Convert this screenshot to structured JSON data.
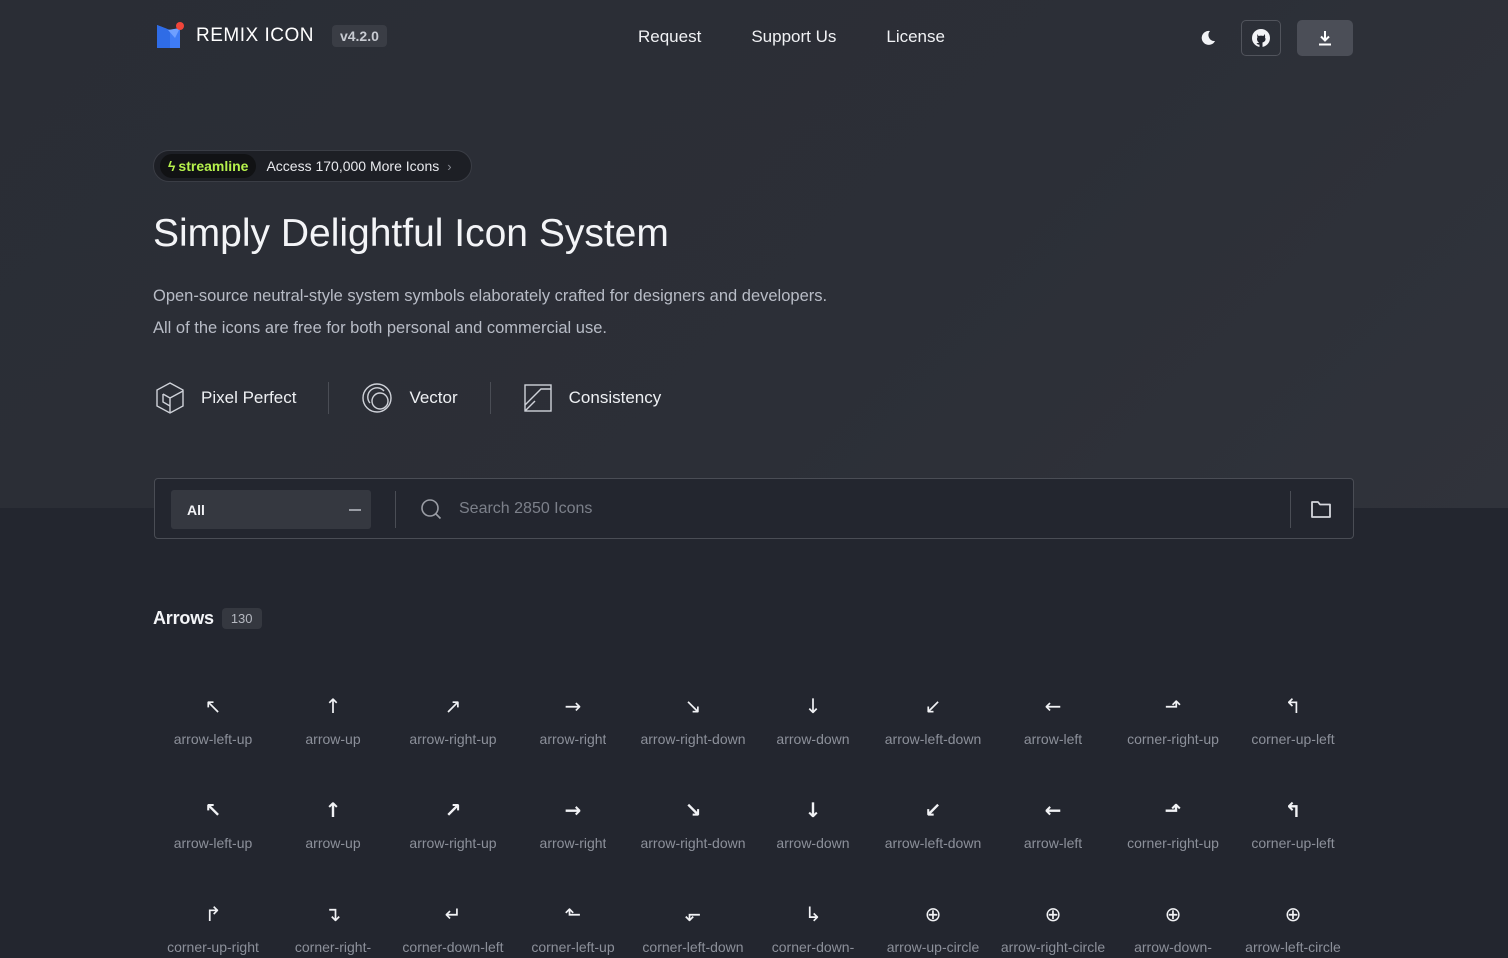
{
  "header": {
    "logo_text": "REMIX ICON",
    "version": "v4.2.0",
    "nav": [
      "Request",
      "Support Us",
      "License"
    ],
    "theme_icon": "moon-icon",
    "github_icon": "github-icon",
    "download_icon": "download-icon"
  },
  "promo": {
    "brand": "streamline",
    "text": "Access 170,000 More Icons",
    "chevron": "›"
  },
  "hero": {
    "title": "Simply Delightful Icon System",
    "desc_line1": "Open-source neutral-style system symbols elaborately crafted for designers and developers.",
    "desc_line2": "All of the icons are free for both personal and commercial use."
  },
  "features": [
    {
      "label": "Pixel Perfect",
      "icon": "cube-icon"
    },
    {
      "label": "Vector",
      "icon": "vector-circle-icon"
    },
    {
      "label": "Consistency",
      "icon": "consistency-icon"
    }
  ],
  "search": {
    "category": "All",
    "placeholder": "Search 2850 Icons"
  },
  "section": {
    "name": "Arrows",
    "count": "130"
  },
  "icons": [
    {
      "glyph": "↖",
      "label": "arrow-left-up"
    },
    {
      "glyph": "↑",
      "label": "arrow-up"
    },
    {
      "glyph": "↗",
      "label": "arrow-right-up"
    },
    {
      "glyph": "→",
      "label": "arrow-right"
    },
    {
      "glyph": "↘",
      "label": "arrow-right-down"
    },
    {
      "glyph": "↓",
      "label": "arrow-down"
    },
    {
      "glyph": "↙",
      "label": "arrow-left-down"
    },
    {
      "glyph": "←",
      "label": "arrow-left"
    },
    {
      "glyph": "⬏",
      "label": "corner-right-up"
    },
    {
      "glyph": "↰",
      "label": "corner-up-left"
    },
    {
      "glyph": "↖",
      "label": "arrow-left-up"
    },
    {
      "glyph": "↑",
      "label": "arrow-up"
    },
    {
      "glyph": "↗",
      "label": "arrow-right-up"
    },
    {
      "glyph": "→",
      "label": "arrow-right"
    },
    {
      "glyph": "↘",
      "label": "arrow-right-down"
    },
    {
      "glyph": "↓",
      "label": "arrow-down"
    },
    {
      "glyph": "↙",
      "label": "arrow-left-down"
    },
    {
      "glyph": "←",
      "label": "arrow-left"
    },
    {
      "glyph": "⬏",
      "label": "corner-right-up"
    },
    {
      "glyph": "↰",
      "label": "corner-up-left"
    },
    {
      "glyph": "↱",
      "label": "corner-up-right"
    },
    {
      "glyph": "↴",
      "label": "corner-right-"
    },
    {
      "glyph": "↵",
      "label": "corner-down-left"
    },
    {
      "glyph": "⬑",
      "label": "corner-left-up"
    },
    {
      "glyph": "⬐",
      "label": "corner-left-down"
    },
    {
      "glyph": "↳",
      "label": "corner-down-"
    },
    {
      "glyph": "⊕",
      "label": "arrow-up-circle"
    },
    {
      "glyph": "⊕",
      "label": "arrow-right-circle"
    },
    {
      "glyph": "⊕",
      "label": "arrow-down-"
    },
    {
      "glyph": "⊕",
      "label": "arrow-left-circle"
    }
  ]
}
